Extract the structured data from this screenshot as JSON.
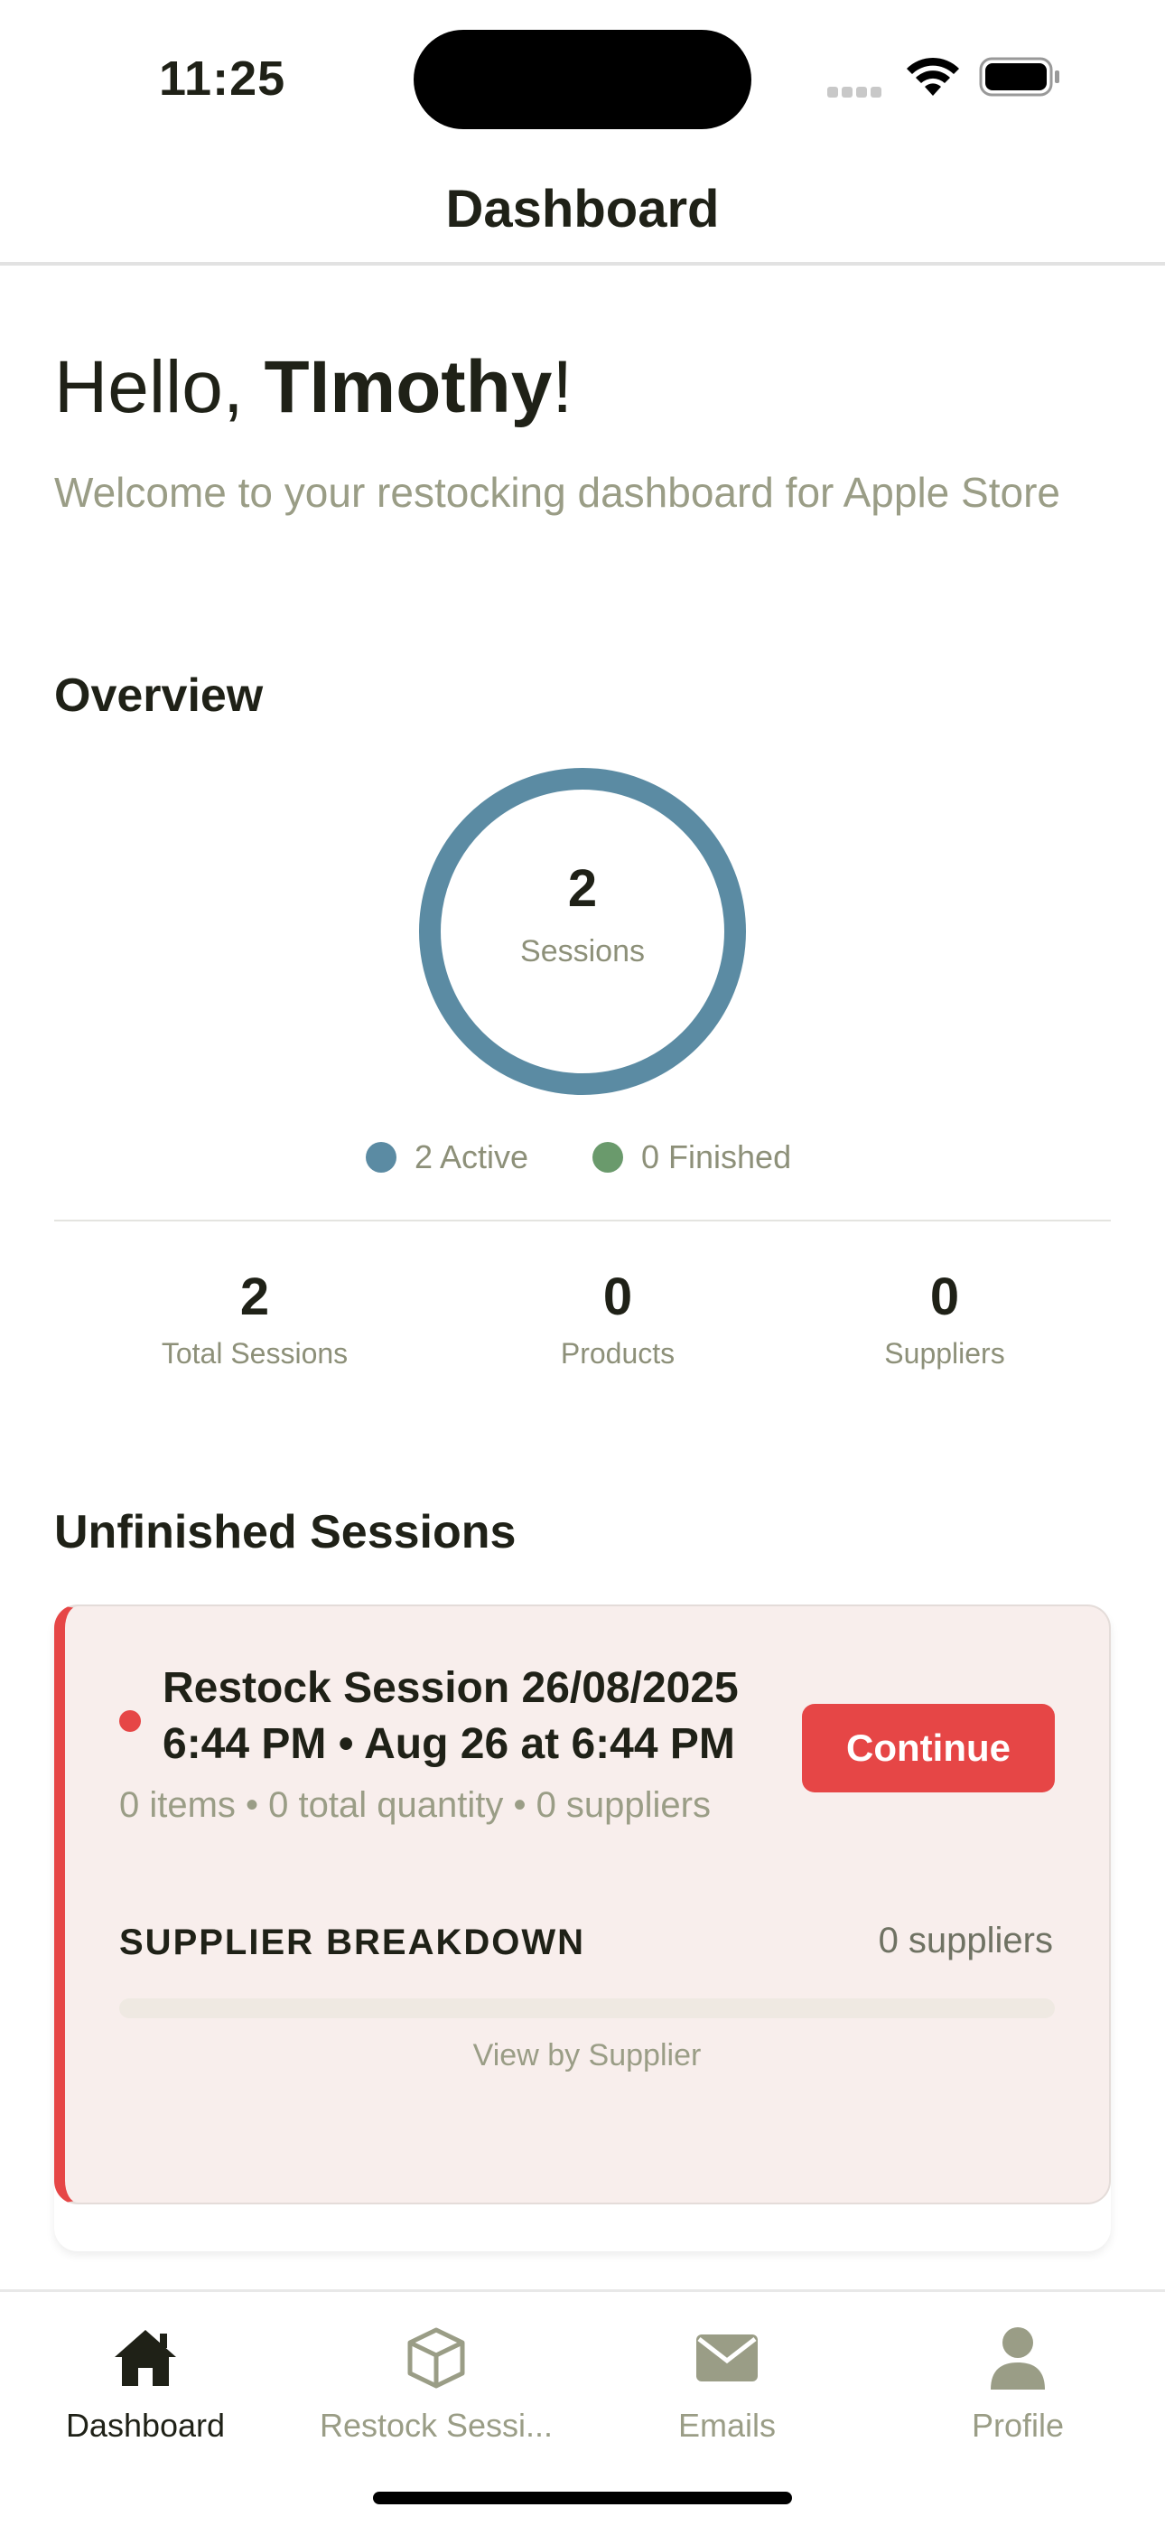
{
  "status_bar": {
    "time": "11:25"
  },
  "header": {
    "title": "Dashboard"
  },
  "greeting": {
    "prefix": "Hello, ",
    "name": "TImothy",
    "suffix": "!",
    "subtitle": "Welcome to your restocking dashboard for Apple Store"
  },
  "overview": {
    "heading": "Overview",
    "ring_value": "2",
    "ring_label": "Sessions",
    "legend": [
      {
        "label": "2 Active",
        "color": "#5b8ba3"
      },
      {
        "label": "0 Finished",
        "color": "#6a9a6c"
      }
    ],
    "stats": [
      {
        "value": "2",
        "label": "Total Sessions"
      },
      {
        "value": "0",
        "label": "Products"
      },
      {
        "value": "0",
        "label": "Suppliers"
      }
    ]
  },
  "unfinished": {
    "heading": "Unfinished Sessions",
    "session": {
      "title": "Restock Session 26/08/2025 6:44 PM • Aug 26 at 6:44 PM",
      "meta": "0 items • 0 total quantity • 0 suppliers",
      "continue_label": "Continue",
      "breakdown_title": "SUPPLIER BREAKDOWN",
      "breakdown_count": "0 suppliers",
      "view_by_supplier": "View by Supplier"
    }
  },
  "tab_bar": [
    {
      "label": "Dashboard",
      "icon": "home-icon",
      "active": true
    },
    {
      "label": "Restock Sessi...",
      "icon": "box-icon",
      "active": false
    },
    {
      "label": "Emails",
      "icon": "mail-icon",
      "active": false
    },
    {
      "label": "Profile",
      "icon": "person-icon",
      "active": false
    }
  ],
  "colors": {
    "accent": "#e64646",
    "ring": "#5b8ba3",
    "muted": "#9a9d86"
  }
}
